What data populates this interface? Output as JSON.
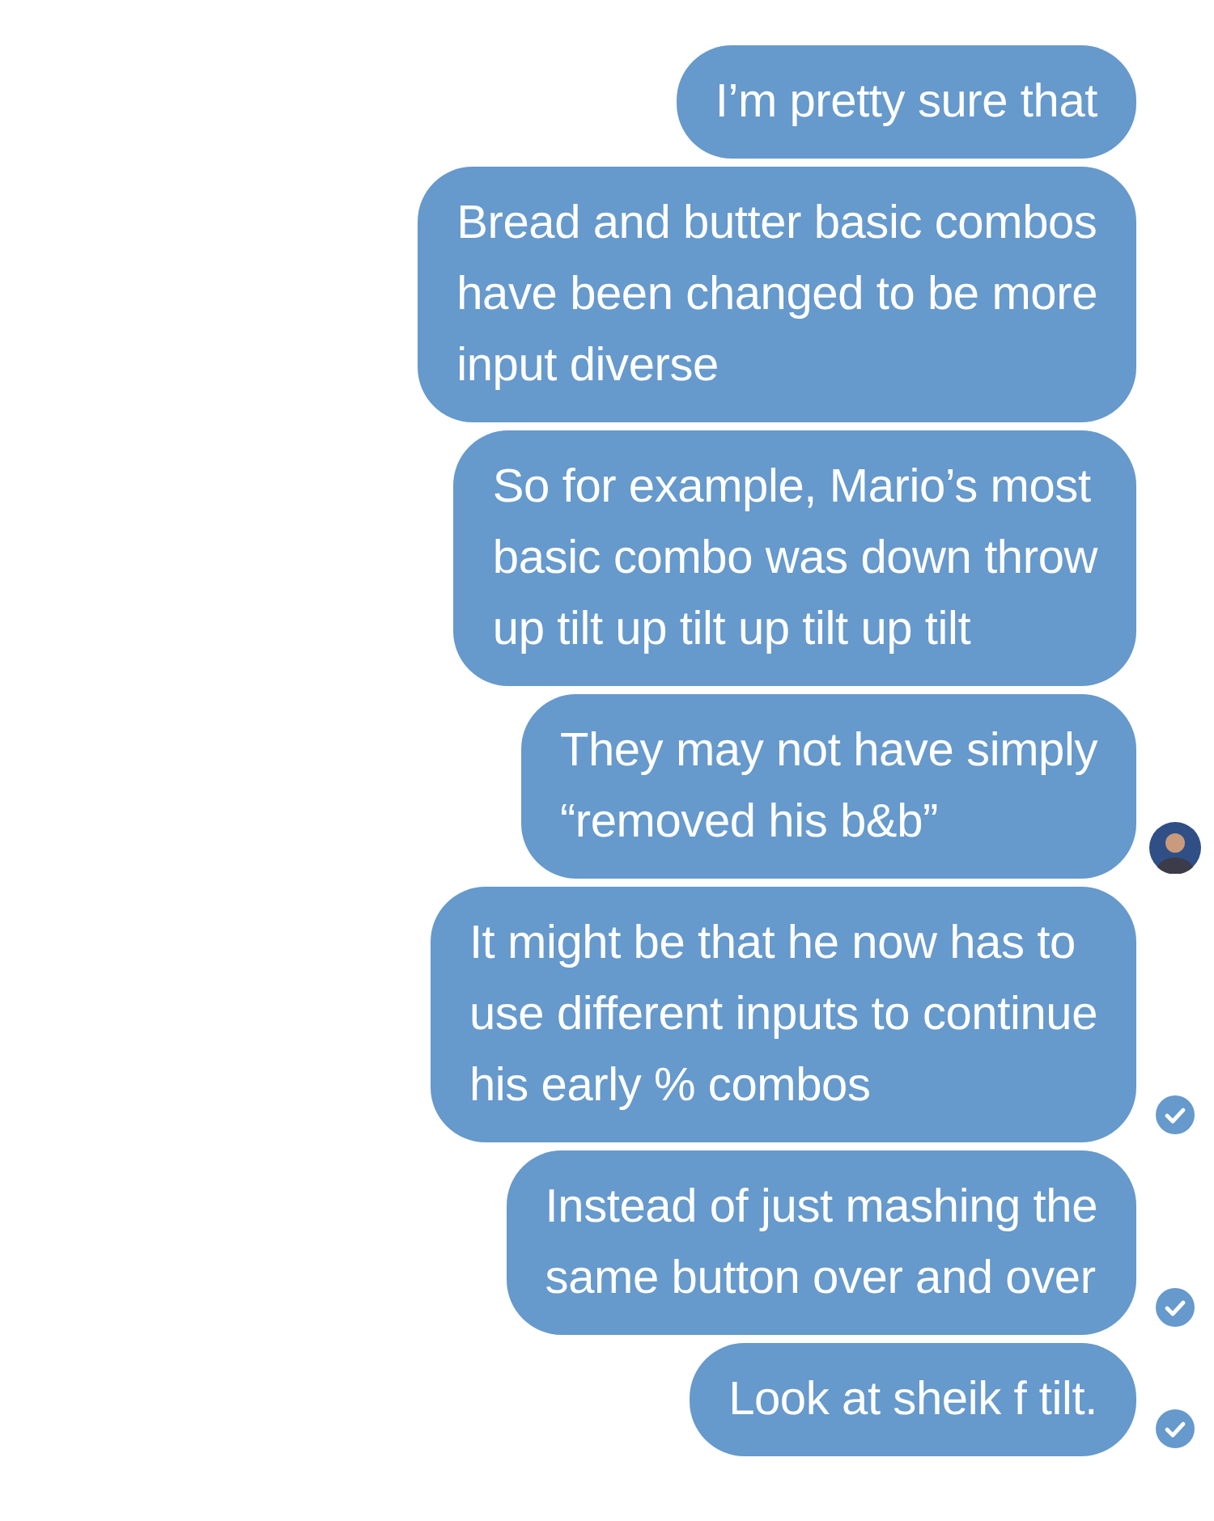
{
  "messages": [
    {
      "text": "I’m pretty sure that",
      "kind": "plain"
    },
    {
      "text": "Bread and butter basic combos\nhave been changed to be more\ninput diverse",
      "kind": "plain"
    },
    {
      "text": "So for example, Mario’s most\nbasic combo was down throw\nup tilt up tilt up tilt up tilt",
      "kind": "plain"
    },
    {
      "text": "They may not have simply\n“removed his b&b”",
      "kind": "avatar"
    },
    {
      "text": "It might be that he now has to\nuse different inputs to continue\nhis early % combos",
      "kind": "delivered"
    },
    {
      "text": "Instead of just mashing the\nsame button over and over",
      "kind": "delivered"
    },
    {
      "text": "Look at sheik f tilt.",
      "kind": "delivered"
    }
  ]
}
